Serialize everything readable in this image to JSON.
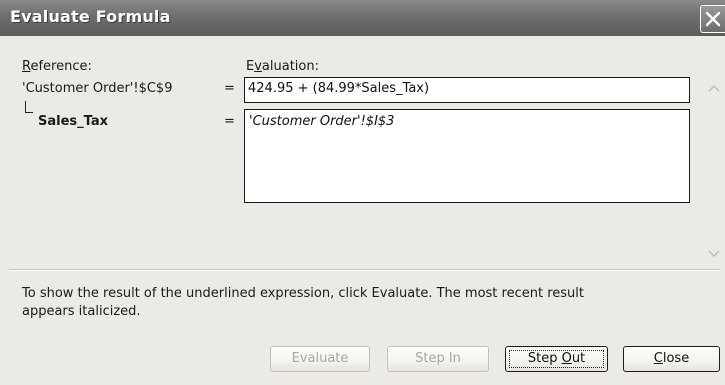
{
  "window": {
    "title": "Evaluate Formula"
  },
  "labels": {
    "reference": "Reference:",
    "evaluation": "Evaluation:"
  },
  "rows": [
    {
      "reference": "'Customer Order'!$C$9",
      "equals": "=",
      "evaluation": "424.95 + (84.99*Sales_Tax)"
    },
    {
      "reference": "Sales_Tax",
      "equals": "=",
      "evaluation": "'Customer Order'!$I$3"
    }
  ],
  "hint": {
    "line1": "To show the result of the underlined expression, click Evaluate.  The most recent result",
    "line2": "appears italicized."
  },
  "buttons": {
    "evaluate": "Evaluate",
    "step_in": "Step In",
    "step_out": "Step Out",
    "close": "Close"
  },
  "icons": {
    "close": "close-icon",
    "scroll_up": "chevron-up-icon",
    "scroll_down": "chevron-down-icon"
  },
  "colors": {
    "titlebar": "#6e6e6e",
    "dialog_bg": "#eceae4",
    "disabled_text": "#a9a79f"
  }
}
